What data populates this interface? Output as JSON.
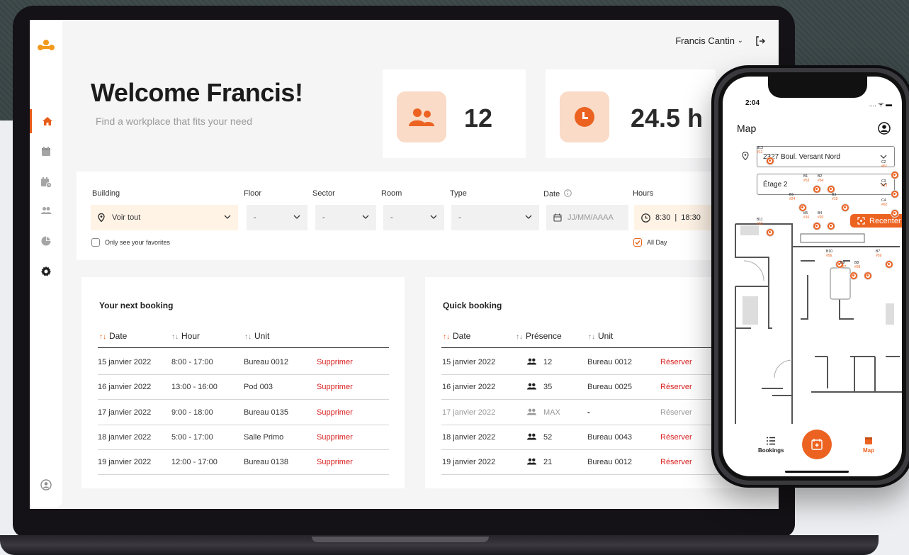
{
  "app": {
    "user_name": "Francis Cantin",
    "welcome_title": "Welcome Francis!",
    "welcome_subtitle": "Find a workplace that fits your need"
  },
  "colors": {
    "accent": "#e85c1a",
    "accent_soft": "#f9dbc8",
    "danger": "#d81e1e",
    "logo": "#f29a1f"
  },
  "sidebar": {
    "items": [
      {
        "icon": "home-icon",
        "active": true
      },
      {
        "icon": "calendar-icon",
        "active": false
      },
      {
        "icon": "calendar-clock-icon",
        "active": false
      },
      {
        "icon": "users-icon",
        "active": false
      },
      {
        "icon": "pie-chart-icon",
        "active": false
      },
      {
        "icon": "gear-icon",
        "active": false
      }
    ],
    "bottom_icon": "profile-icon"
  },
  "stats": [
    {
      "icon": "users-icon",
      "value": "12"
    },
    {
      "icon": "clock-icon",
      "value": "24.5 h"
    }
  ],
  "filters": {
    "building": {
      "label": "Building",
      "value": "Voir tout"
    },
    "floor": {
      "label": "Floor",
      "value": "-"
    },
    "sector": {
      "label": "Sector",
      "value": "-"
    },
    "room": {
      "label": "Room",
      "value": "-"
    },
    "type": {
      "label": "Type",
      "value": "-"
    },
    "date": {
      "label": "Date",
      "placeholder": "JJ/MM/AAAA"
    },
    "hours": {
      "label": "Hours",
      "start": "8:30",
      "end": "18:30",
      "separator": "|"
    },
    "favorites_label": "Only see your favorites",
    "all_day_label": "All Day",
    "all_day_checked": true
  },
  "next_booking": {
    "title": "Your next booking",
    "columns": [
      "Date",
      "Hour",
      "Unit"
    ],
    "sort_arrow": "↑↓",
    "rows": [
      {
        "date": "15 janvier 2022",
        "hour": "8:00 - 17:00",
        "unit": "Bureau 0012",
        "action": "Supprimer"
      },
      {
        "date": "16 janvier 2022",
        "hour": "13:00 - 16:00",
        "unit": "Pod 003",
        "action": "Supprimer"
      },
      {
        "date": "17 janvier 2022",
        "hour": "9:00 - 18:00",
        "unit": "Bureau 0135",
        "action": "Supprimer"
      },
      {
        "date": "18 janvier 2022",
        "hour": "5:00 - 17:00",
        "unit": "Salle Primo",
        "action": "Supprimer"
      },
      {
        "date": "19 janvier 2022",
        "hour": "12:00 - 17:00",
        "unit": "Bureau 0138",
        "action": "Supprimer"
      }
    ]
  },
  "quick_booking": {
    "title": "Quick booking",
    "columns": [
      "Date",
      "Présence",
      "Unit"
    ],
    "rows": [
      {
        "date": "15 janvier 2022",
        "presence": "12",
        "unit": "Bureau 0012",
        "action": "Réserver",
        "disabled": false
      },
      {
        "date": "16 janvier 2022",
        "presence": "35",
        "unit": "Bureau 0025",
        "action": "Réserver",
        "disabled": false
      },
      {
        "date": "17 janvier 2022",
        "presence": "MAX",
        "unit": "-",
        "action": "Réserver",
        "disabled": true
      },
      {
        "date": "18 janvier 2022",
        "presence": "52",
        "unit": "Bureau 0043",
        "action": "Réserver",
        "disabled": false
      },
      {
        "date": "19 janvier 2022",
        "presence": "21",
        "unit": "Bureau 0012",
        "action": "Réserver",
        "disabled": false
      }
    ]
  },
  "phone": {
    "time": "2:04",
    "status": ".... ᯤ ▬",
    "title": "Map",
    "address": "2327 Boul. Versant Nord",
    "floor": "Étage 2",
    "recenter_label": "Recenter",
    "desks": [
      {
        "label": "B13",
        "sub": "#12"
      },
      {
        "label": "B1",
        "sub": "#53"
      },
      {
        "label": "B2",
        "sub": "#54"
      },
      {
        "label": "B3",
        "sub": "#19"
      },
      {
        "label": "B4",
        "sub": "#20"
      },
      {
        "label": "B5",
        "sub": "#16"
      },
      {
        "label": "B6",
        "sub": "#24"
      },
      {
        "label": "B11",
        "sub": "#18"
      },
      {
        "label": "B10",
        "sub": "#56"
      },
      {
        "label": "B9",
        "sub": "#57"
      },
      {
        "label": "B8",
        "sub": "#58"
      },
      {
        "label": "B7",
        "sub": "#59"
      },
      {
        "label": "C2",
        "sub": "#61"
      },
      {
        "label": "C3",
        "sub": "#13"
      },
      {
        "label": "C4",
        "sub": "#62"
      }
    ],
    "tabs": {
      "bookings": "Bookings",
      "map": "Map"
    }
  }
}
